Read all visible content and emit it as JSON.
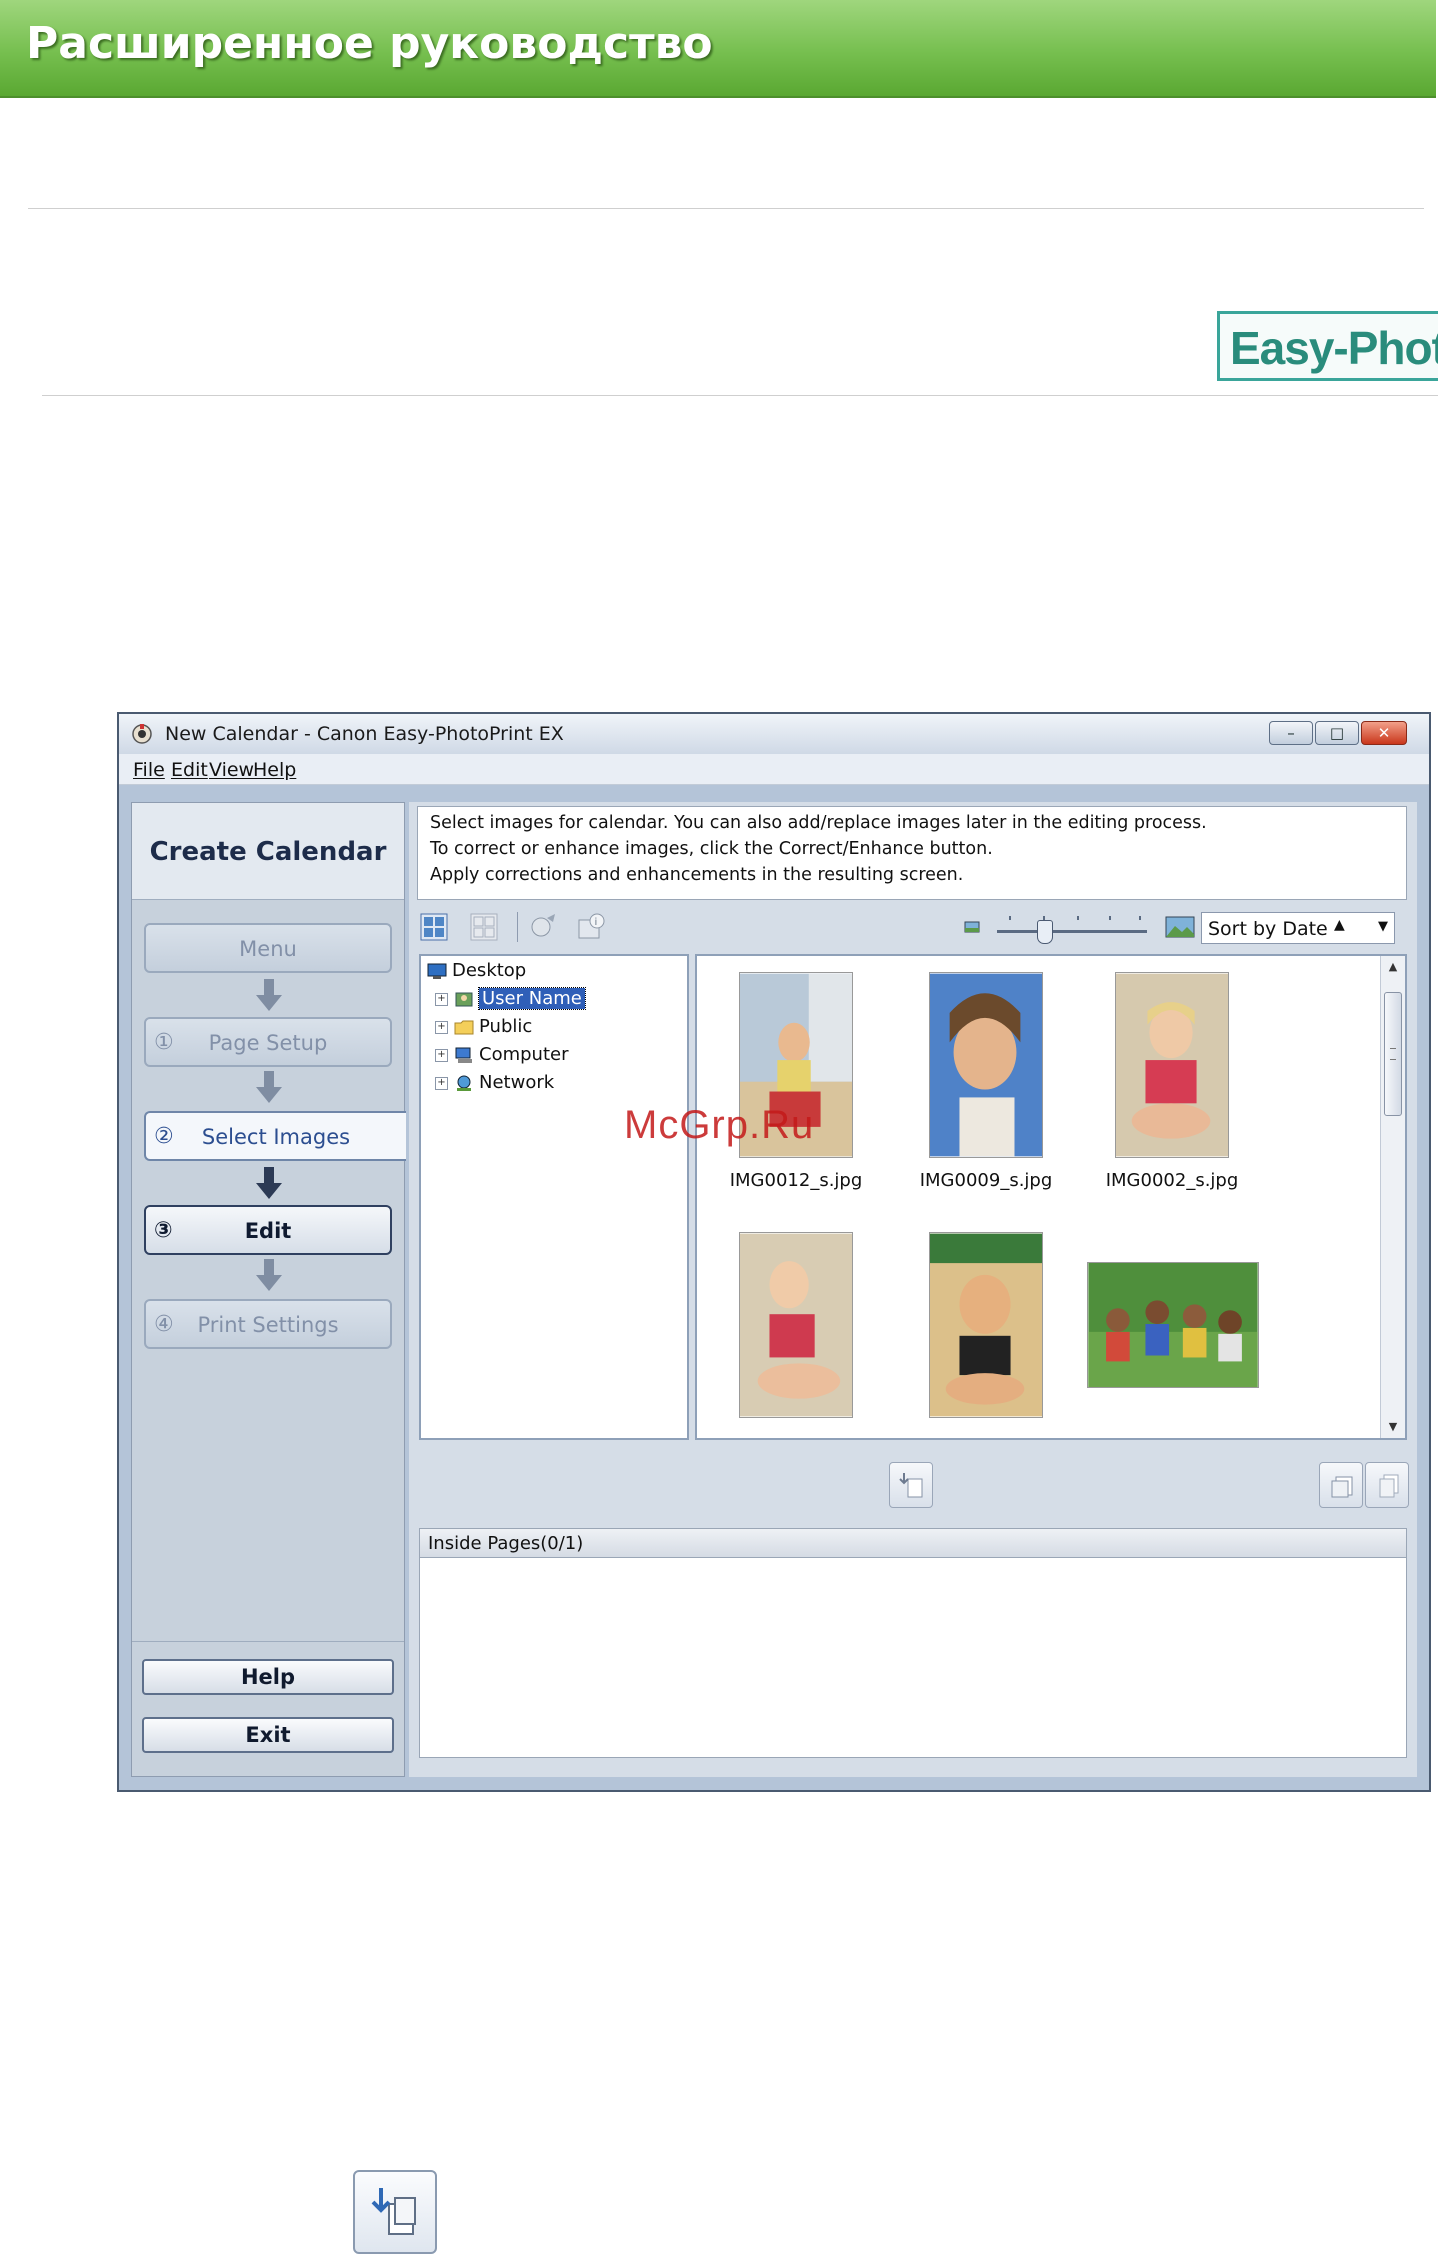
{
  "page": {
    "header_title": "Расширенное руководство",
    "logo_text": "Easy-PhotoP",
    "watermark": "McGrp.Ru"
  },
  "window": {
    "title": "New Calendar - Canon Easy-PhotoPrint EX",
    "menu": [
      "File",
      "Edit",
      "View",
      "Help"
    ]
  },
  "left_panel": {
    "title": "Create Calendar",
    "steps": [
      {
        "num": "",
        "label": "Menu"
      },
      {
        "num": "①",
        "label": "Page Setup"
      },
      {
        "num": "②",
        "label": "Select Images"
      },
      {
        "num": "③",
        "label": "Edit"
      },
      {
        "num": "④",
        "label": "Print Settings"
      }
    ],
    "help_label": "Help",
    "exit_label": "Exit"
  },
  "instructions": [
    "Select images for calendar. You can also add/replace images later in the editing process.",
    "To correct or enhance images, click the Correct/Enhance button.",
    "Apply corrections and enhancements in the resulting screen."
  ],
  "toolbar": {
    "sort_value": "Sort by Date",
    "icons": [
      "select-all-icon",
      "deselect-all-icon",
      "correct-enhance-icon",
      "image-info-icon",
      "small-image-icon",
      "large-image-icon"
    ]
  },
  "tree": {
    "root": "Desktop",
    "children": [
      "User Name",
      "Public",
      "Computer",
      "Network"
    ],
    "selected": "User Name"
  },
  "thumbnails": [
    {
      "filename": "IMG0012_s.jpg"
    },
    {
      "filename": "IMG0009_s.jpg"
    },
    {
      "filename": "IMG0002_s.jpg"
    },
    {
      "filename": ""
    },
    {
      "filename": ""
    },
    {
      "filename": ""
    }
  ],
  "pages_panel": {
    "header": "Inside Pages(0/1)"
  },
  "colors": {
    "banner_green": "#76bf4f",
    "logo_teal": "#2a8c7c",
    "watermark_red": "#c41a1a",
    "selection_blue": "#2f5fb8"
  }
}
